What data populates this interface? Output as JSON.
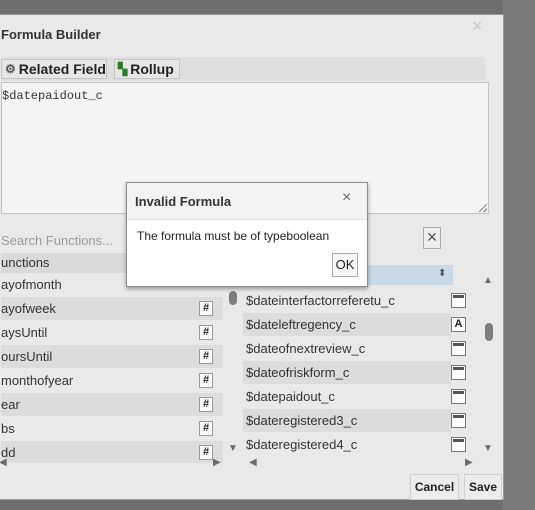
{
  "builder": {
    "title": "Formula Builder",
    "close_glyph": "×"
  },
  "toolbar": {
    "related_field_label": "Related Field",
    "rollup_label": "Rollup"
  },
  "editor": {
    "value": "$datepaidout_c"
  },
  "functions": {
    "search_placeholder": "Search Functions...",
    "header": "unctions",
    "items": [
      "ayofmonth",
      "ayofweek",
      "aysUntil",
      "oursUntil",
      "monthofyear",
      "ear",
      "bs",
      "dd"
    ],
    "item_icon": "#"
  },
  "fields": {
    "clear_glyph": "×",
    "items": [
      {
        "name": "$dateinterfactorreferetu_c",
        "icon": "calendar-icon"
      },
      {
        "name": "$dateleftregency_c",
        "icon": "text-icon",
        "icon_text": "A"
      },
      {
        "name": "$dateofnextreview_c",
        "icon": "calendar-icon"
      },
      {
        "name": "$dateofriskform_c",
        "icon": "calendar-icon"
      },
      {
        "name": "$datepaidout_c",
        "icon": "calendar-icon"
      },
      {
        "name": "$dateregistered3_c",
        "icon": "calendar-icon"
      },
      {
        "name": "$dateregistered4_c",
        "icon": "calendar-icon"
      }
    ]
  },
  "footer": {
    "cancel_label": "Cancel",
    "save_label": "Save"
  },
  "dialog": {
    "title": "Invalid Formula",
    "close_glyph": "×",
    "message": "The formula must be of typeboolean",
    "ok_label": "OK"
  }
}
